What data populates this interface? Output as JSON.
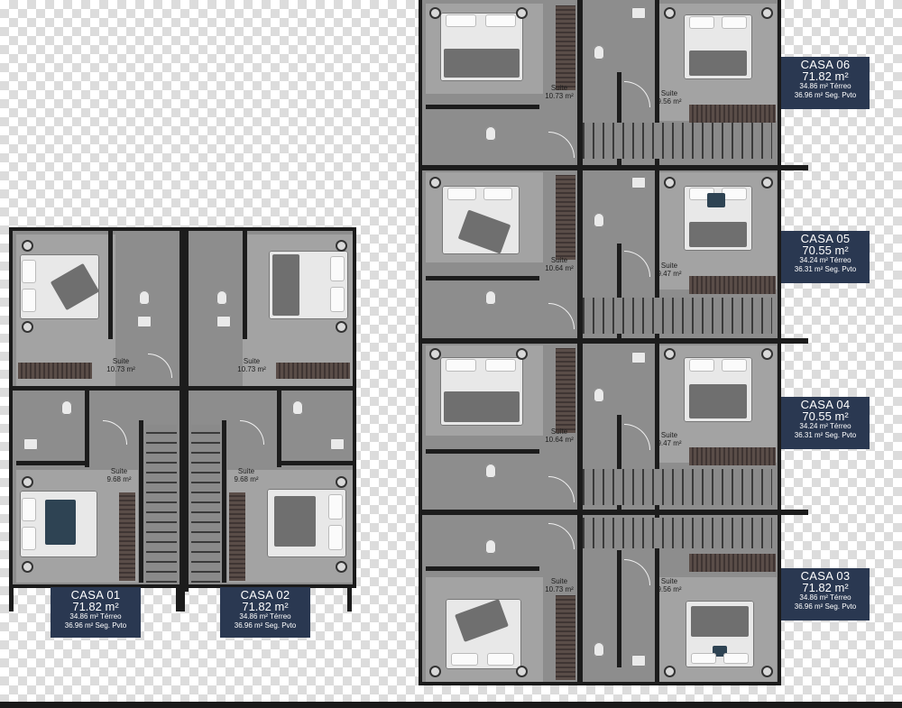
{
  "houses": [
    {
      "name": "CASA 01",
      "area": "71.82 m²",
      "terreo": "34.86 m² Térreo",
      "seg": "36.96 m² Seg. Pvto"
    },
    {
      "name": "CASA 02",
      "area": "71.82 m²",
      "terreo": "34.86 m² Térreo",
      "seg": "36.96 m² Seg. Pvto"
    },
    {
      "name": "CASA 06",
      "area": "71.82 m²",
      "terreo": "34.86 m² Térreo",
      "seg": "36.96 m² Seg. Pvto"
    },
    {
      "name": "CASA 05",
      "area": "70.55 m²",
      "terreo": "34.24 m² Térreo",
      "seg": "36.31 m² Seg. Pvto"
    },
    {
      "name": "CASA 04",
      "area": "70.55 m²",
      "terreo": "34.24 m² Térreo",
      "seg": "36.31 m² Seg. Pvto"
    },
    {
      "name": "CASA 03",
      "area": "71.82 m²",
      "terreo": "34.86 m² Térreo",
      "seg": "36.96 m² Seg. Pvto"
    }
  ],
  "suites": [
    {
      "label": "Suite",
      "area": "10.73 m²"
    },
    {
      "label": "Suite",
      "area": "10.73 m²"
    },
    {
      "label": "Suite",
      "area": "9.68 m²"
    },
    {
      "label": "Suite",
      "area": "9.68 m²"
    },
    {
      "label": "Suite",
      "area": "10.73 m²"
    },
    {
      "label": "Suite",
      "area": "9.56 m²"
    },
    {
      "label": "Suite",
      "area": "10.64 m²"
    },
    {
      "label": "Suite",
      "area": "9.47 m²"
    },
    {
      "label": "Suite",
      "area": "10.64 m²"
    },
    {
      "label": "Suite",
      "area": "9.47 m²"
    },
    {
      "label": "Suite",
      "area": "10.73 m²"
    },
    {
      "label": "Suite",
      "area": "9.56 m²"
    }
  ]
}
